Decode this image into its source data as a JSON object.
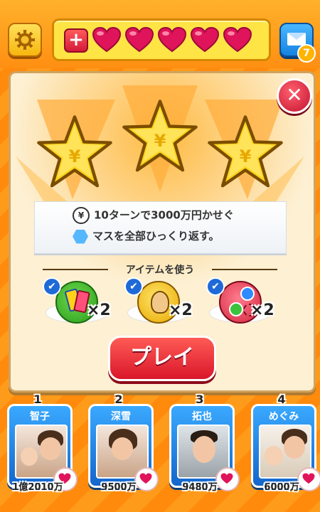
{
  "header": {
    "plus_label": "+",
    "hearts": [
      "heart",
      "heart",
      "heart",
      "heart",
      "heart"
    ],
    "mail_badge": "7"
  },
  "dialog": {
    "close_label": "✕",
    "stars_earned": 3,
    "goals": [
      {
        "icon": "yen-icon",
        "icon_text": "¥",
        "text": "10ターンで3000万円かせぐ"
      },
      {
        "icon": "hexagon-icon",
        "text": "マスを全部ひっくり返す。"
      }
    ],
    "items_heading": "アイテムを使う",
    "items": [
      {
        "name": "cards",
        "qty": "×2"
      },
      {
        "name": "man-coin",
        "qty": "×2"
      },
      {
        "name": "currency-coins",
        "qty": "×2"
      }
    ],
    "play_label": "プレイ"
  },
  "leaderboard": [
    {
      "rank": "1",
      "name": "智子",
      "score": "1億2010万"
    },
    {
      "rank": "2",
      "name": "深雪",
      "score": "9500万"
    },
    {
      "rank": "3",
      "name": "拓也",
      "score": "9480万"
    },
    {
      "rank": "4",
      "name": "めぐみ",
      "score": "6000万"
    }
  ],
  "colors": {
    "accent": "#ff9b1a",
    "heart": "#e0145a",
    "play": "#d9162a",
    "card": "#1e7ee8"
  }
}
